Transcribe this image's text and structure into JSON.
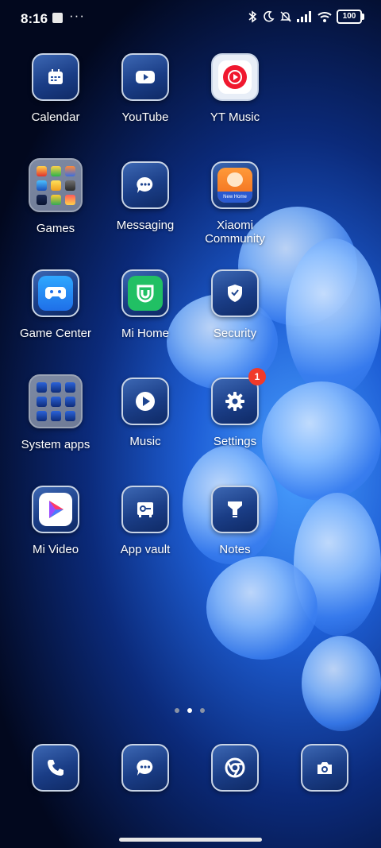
{
  "status": {
    "time": "8:16",
    "battery": "100"
  },
  "apps": {
    "calendar": "Calendar",
    "youtube": "YouTube",
    "ytmusic": "YT Music",
    "games": "Games",
    "messaging": "Messaging",
    "community": "Xiaomi Community",
    "community_badge_text": "New Home",
    "gamecenter": "Game Center",
    "mihome": "Mi Home",
    "security": "Security",
    "systemapps": "System apps",
    "music": "Music",
    "settings": "Settings",
    "settings_badge": "1",
    "mivideo": "Mi Video",
    "appvault": "App vault",
    "notes": "Notes"
  },
  "pager": {
    "total": 3,
    "current": 2
  },
  "colors": {
    "badge": "#f03a2a",
    "tile_border": "#c8d4e6",
    "mihome_green": "#21c064",
    "ytmusic_red": "#f0182e"
  },
  "dock": [
    "phone-icon",
    "messaging-icon",
    "chrome-icon",
    "camera-icon"
  ]
}
